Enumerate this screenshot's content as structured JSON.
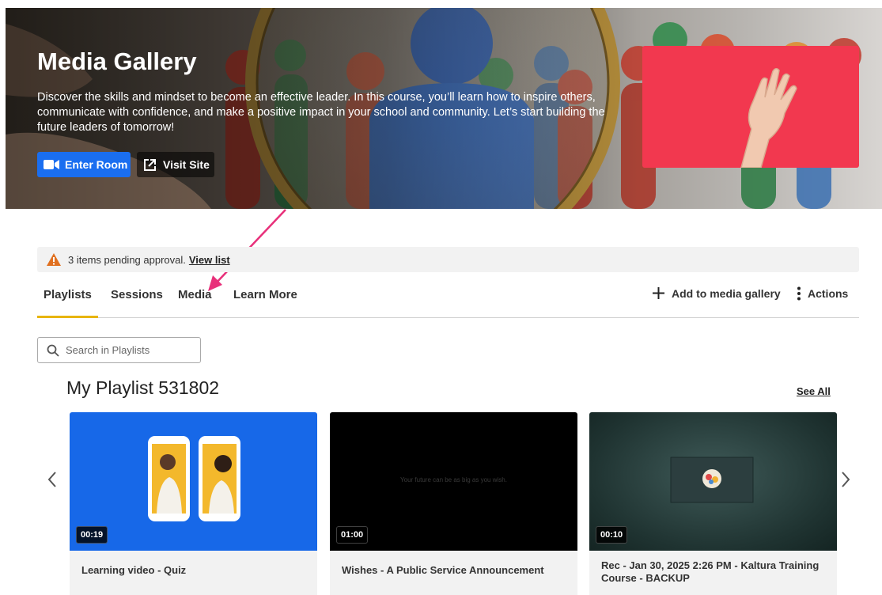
{
  "hero": {
    "title": "Media Gallery",
    "description": "Discover the skills and mindset to become an effective leader. In this course, you’ll learn how to inspire others, communicate with confidence, and make a positive impact in your school and community. Let’s start building the future leaders of tomorrow!",
    "enter_room_label": "Enter Room",
    "visit_site_label": "Visit Site"
  },
  "alert": {
    "text": "3 items pending approval.",
    "link_label": "View list"
  },
  "tabs": [
    {
      "label": "Playlists",
      "active": true
    },
    {
      "label": "Sessions",
      "active": false
    },
    {
      "label": "Media",
      "active": false
    },
    {
      "label": "Learn More",
      "active": false
    }
  ],
  "actions": {
    "add_label": "Add to media gallery",
    "actions_label": "Actions"
  },
  "search": {
    "placeholder": "Search in Playlists"
  },
  "playlist": {
    "title": "My Playlist 531802",
    "see_all_label": "See All",
    "items": [
      {
        "title": "Learning video - Quiz",
        "duration": "00:19"
      },
      {
        "title": "Wishes - A Public Service Announcement",
        "duration": "01:00",
        "overlay_text": "Your future can be as big as you wish."
      },
      {
        "title": "Rec - Jan 30, 2025 2:26 PM - Kaltura Training Course - BACKUP",
        "duration": "00:10"
      }
    ]
  },
  "colors": {
    "primary_button": "#1a6ef0",
    "active_tab_underline": "#e8b500",
    "annotation_arrow": "#e8307a",
    "hero_thumb_bg": "#f2384f",
    "warning": "#e07020"
  }
}
